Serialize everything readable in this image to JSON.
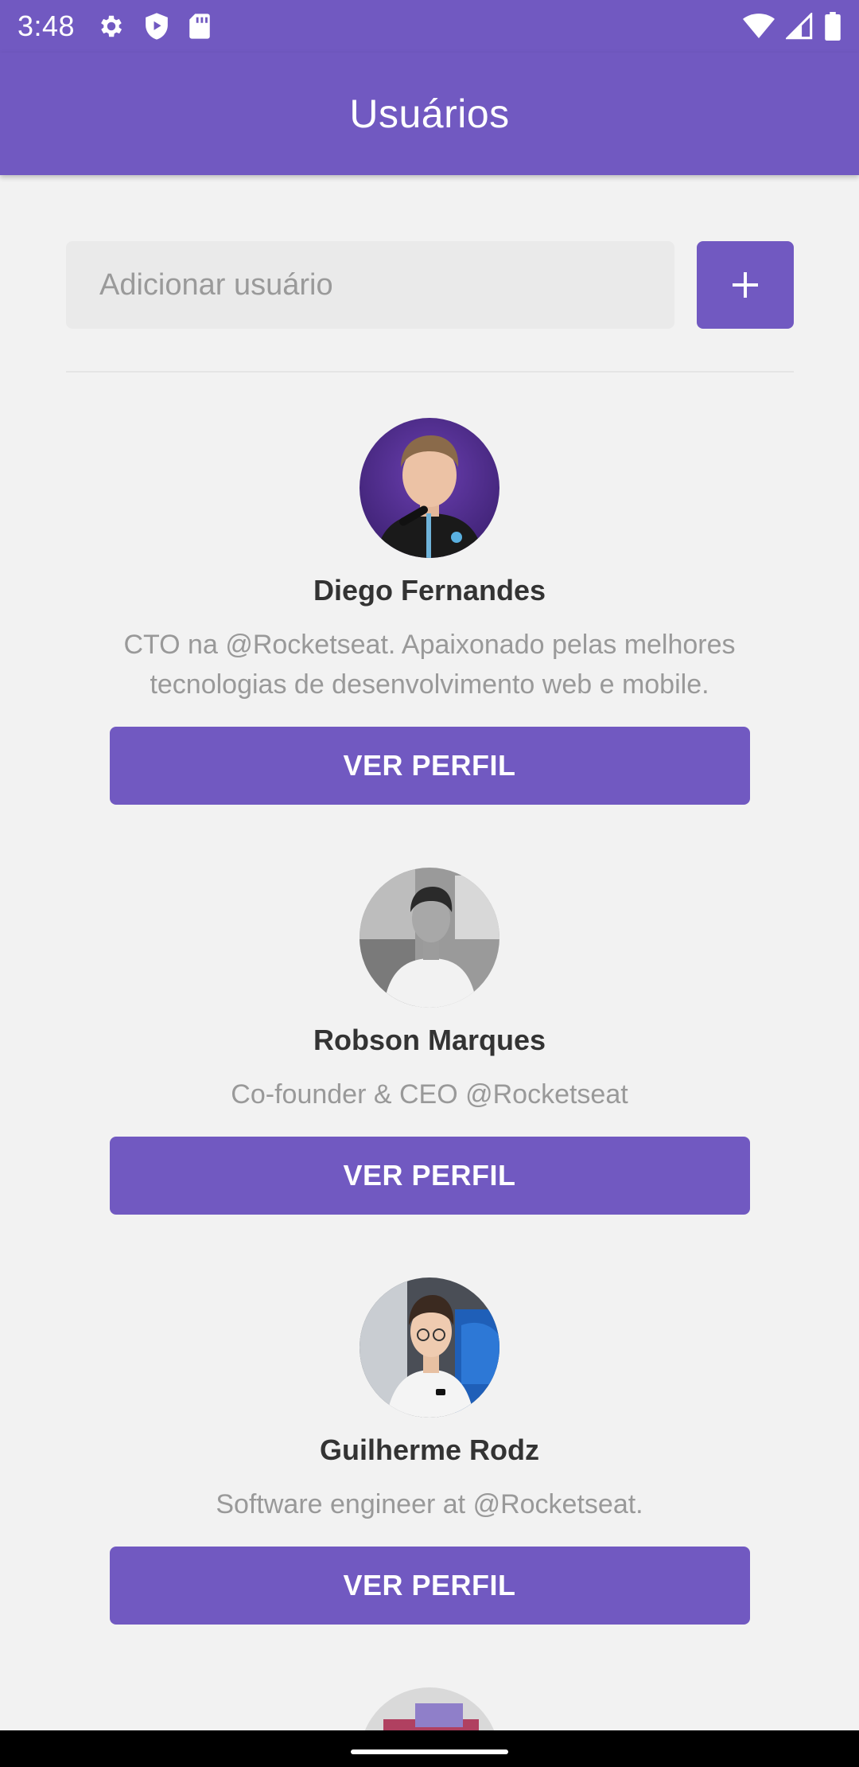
{
  "status_bar": {
    "time": "3:48",
    "icons_left": [
      "gear-icon",
      "shield-play-icon",
      "sd-card-icon"
    ],
    "icons_right": [
      "wifi-icon",
      "signal-icon",
      "battery-icon"
    ]
  },
  "header": {
    "title": "Usuários"
  },
  "form": {
    "placeholder": "Adicionar usuário",
    "add_icon": "plus-icon"
  },
  "users": [
    {
      "name": "Diego Fernandes",
      "bio": "CTO na @Rocketseat. Apaixonado pelas melhores tecnologias de desenvolvimento web e mobile.",
      "button": "VER PERFIL"
    },
    {
      "name": "Robson Marques",
      "bio": "Co-founder & CEO @Rocketseat",
      "button": "VER PERFIL"
    },
    {
      "name": "Guilherme Rodz",
      "bio": "Software engineer at @Rocketseat.",
      "button": "VER PERFIL"
    }
  ],
  "colors": {
    "primary": "#7159c1",
    "background": "#f2f2f2",
    "name_text": "#333333",
    "bio_text": "#999999"
  }
}
